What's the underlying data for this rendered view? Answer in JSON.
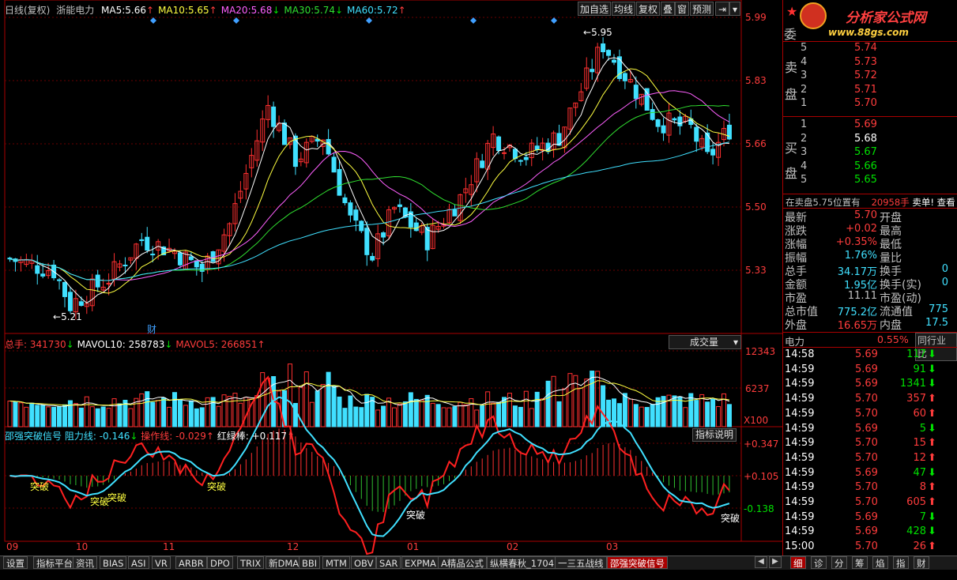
{
  "header": {
    "period": "日线(复权)",
    "stock": "浙能电力",
    "ma": [
      {
        "label": "MA5:",
        "value": "5.66",
        "arrow": "↑",
        "color": "#ffffff"
      },
      {
        "label": "MA10:",
        "value": "5.65",
        "arrow": "↑",
        "color": "#ffff40"
      },
      {
        "label": "MA20:",
        "value": "5.68",
        "arrow": "↓",
        "color": "#ff60ff"
      },
      {
        "label": "MA30:",
        "value": "5.74",
        "arrow": "↓",
        "color": "#30e030"
      },
      {
        "label": "MA60:",
        "value": "5.72",
        "arrow": "↑",
        "color": "#40e0ff"
      }
    ]
  },
  "toolbar": {
    "add_watch": "加自选",
    "ma_line": "均线",
    "adjust": "复权",
    "overlay": "叠",
    "window": "窗",
    "forecast": "预测"
  },
  "logo": {
    "name": "分析家公式网",
    "url": "www.88gs.com"
  },
  "price_axis": [
    "5.99",
    "5.83",
    "5.66",
    "5.50",
    "5.33"
  ],
  "annot": {
    "high": "5.95",
    "low": "5.21",
    "cai": "财"
  },
  "volume_panel": {
    "total": "总手: 341730",
    "total_arrow": "↓",
    "mavol10": "MAVOL10: 258783",
    "mavol10_arrow": "↓",
    "mavol5": "MAVOL5: 266851",
    "mavol5_arrow": "↑",
    "selector": "成交量",
    "axis": [
      "12343",
      "6237"
    ],
    "unit": "X100"
  },
  "indicator_panel": {
    "name": "邵强突破信号",
    "resist": "阻力线: -0.146",
    "resist_arrow": "↓",
    "op": "操作线: -0.029",
    "op_arrow": "↑",
    "bar": "红绿棒: +0.117",
    "bar_arrow": "↑",
    "help": "指标说明",
    "axis": [
      "+0.347",
      "+0.105",
      "-0.138"
    ],
    "signal": "突破"
  },
  "months": [
    "09",
    "10",
    "11",
    "12",
    "01",
    "02",
    "03"
  ],
  "tabs": [
    "设置",
    "指标平台",
    "资讯",
    "BIAS",
    "ASI",
    "VR",
    "ARBR",
    "DPO",
    "TRIX",
    "新DMA",
    "BBI",
    "MTM",
    "OBV",
    "SAR",
    "EXPMA",
    "A精品公式",
    "纵横春秋_1704",
    "一三五战线",
    "邵强突破信号"
  ],
  "order_book": {
    "ask_label": [
      "卖",
      "盘"
    ],
    "bid_label": [
      "买",
      "盘"
    ],
    "committee": "委",
    "asks": [
      {
        "lvl": "5",
        "price": "5.74"
      },
      {
        "lvl": "4",
        "price": "5.73"
      },
      {
        "lvl": "3",
        "price": "5.72"
      },
      {
        "lvl": "2",
        "price": "5.71"
      },
      {
        "lvl": "1",
        "price": "5.70"
      }
    ],
    "bids": [
      {
        "lvl": "1",
        "price": "5.69"
      },
      {
        "lvl": "2",
        "price": "5.68"
      },
      {
        "lvl": "3",
        "price": "5.67"
      },
      {
        "lvl": "4",
        "price": "5.66"
      },
      {
        "lvl": "5",
        "price": "5.65"
      }
    ],
    "notice": "在卖盘5.75位置有",
    "notice_vol": "20958手",
    "notice_tail": "卖单!  查看"
  },
  "quote": [
    {
      "k1": "最新",
      "v1": "5.70",
      "c1": "#ff3c3c",
      "k2": "开盘"
    },
    {
      "k1": "涨跌",
      "v1": "+0.02",
      "c1": "#ff3c3c",
      "k2": "最高"
    },
    {
      "k1": "涨幅",
      "v1": "+0.35%",
      "c1": "#ff3c3c",
      "k2": "最低"
    },
    {
      "k1": "振幅",
      "v1": "1.76%",
      "c1": "#40e0ff",
      "k2": "量比"
    },
    {
      "k1": "总手",
      "v1": "34.17万",
      "c1": "#40e0ff",
      "k2": "换手",
      "v2": "0"
    },
    {
      "k1": "金额",
      "v1": "1.95亿",
      "c1": "#40e0ff",
      "k2": "换手(实)",
      "v2": "0"
    },
    {
      "k1": "市盈",
      "v1": "11.11",
      "c1": "#c0c0c0",
      "k2": "市盈(动)"
    },
    {
      "k1": "总市值",
      "v1": "775.2亿",
      "c1": "#40e0ff",
      "k2": "流通值",
      "v2": "775"
    },
    {
      "k1": "外盘",
      "v1": "16.65万",
      "c1": "#ff3c3c",
      "k2": "内盘",
      "v2": "17.5"
    }
  ],
  "sector": {
    "name": "电力",
    "pct": "0.55%",
    "rank": "同行业比"
  },
  "ticks": [
    {
      "t": "14:58",
      "p": "5.69",
      "v": "117",
      "d": "down"
    },
    {
      "t": "14:59",
      "p": "5.69",
      "v": "91",
      "d": "down"
    },
    {
      "t": "14:59",
      "p": "5.69",
      "v": "1341",
      "d": "down"
    },
    {
      "t": "14:59",
      "p": "5.70",
      "v": "357",
      "d": "up"
    },
    {
      "t": "14:59",
      "p": "5.70",
      "v": "60",
      "d": "up"
    },
    {
      "t": "14:59",
      "p": "5.69",
      "v": "5",
      "d": "down"
    },
    {
      "t": "14:59",
      "p": "5.70",
      "v": "15",
      "d": "up"
    },
    {
      "t": "14:59",
      "p": "5.70",
      "v": "12",
      "d": "up"
    },
    {
      "t": "14:59",
      "p": "5.69",
      "v": "47",
      "d": "down"
    },
    {
      "t": "14:59",
      "p": "5.70",
      "v": "8",
      "d": "up"
    },
    {
      "t": "14:59",
      "p": "5.70",
      "v": "605",
      "d": "up"
    },
    {
      "t": "14:59",
      "p": "5.69",
      "v": "7",
      "d": "down"
    },
    {
      "t": "14:59",
      "p": "5.69",
      "v": "428",
      "d": "down"
    },
    {
      "t": "15:00",
      "p": "5.70",
      "v": "26",
      "d": "up"
    }
  ],
  "right_tabs": [
    "细",
    "诊",
    "分",
    "筹",
    "焰",
    "指",
    "财"
  ]
}
